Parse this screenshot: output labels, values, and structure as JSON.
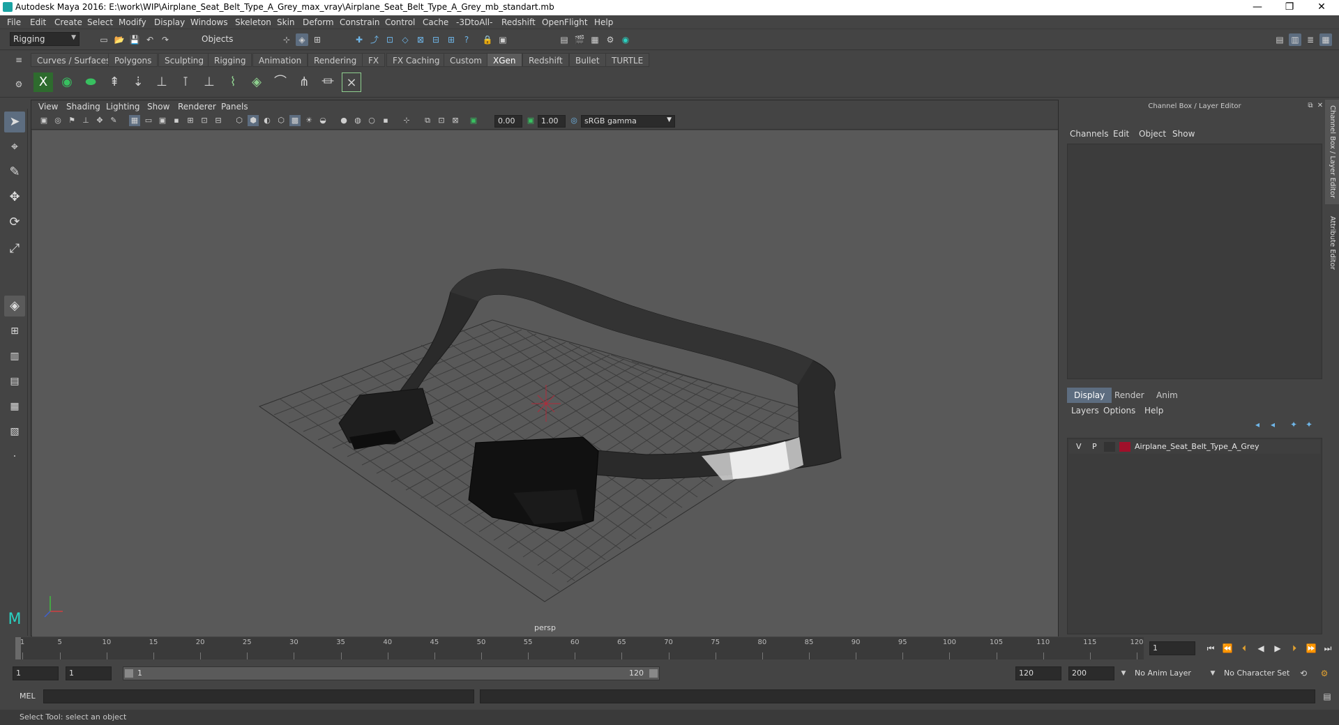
{
  "window": {
    "title": "Autodesk Maya 2016: E:\\work\\WIP\\Airplane_Seat_Belt_Type_A_Grey_max_vray\\Airplane_Seat_Belt_Type_A_Grey_mb_standart.mb",
    "minimize": "—",
    "restore": "❐",
    "close": "✕"
  },
  "menubar": [
    "File",
    "Edit",
    "Create",
    "Select",
    "Modify",
    "Display",
    "Windows",
    "Skeleton",
    "Skin",
    "Deform",
    "Constrain",
    "Control",
    "Cache",
    "-3DtoAll-",
    "Redshift",
    "OpenFlight",
    "Help"
  ],
  "statusline": {
    "menuset": "Rigging",
    "selection_mode": "Objects"
  },
  "shelf_tabs": [
    "Curves / Surfaces",
    "Polygons",
    "Sculpting",
    "Rigging",
    "Animation",
    "Rendering",
    "FX",
    "FX Caching",
    "Custom",
    "XGen",
    "Redshift",
    "Bullet",
    "TURTLE"
  ],
  "active_shelf_tab": "XGen",
  "panel": {
    "menus": [
      "View",
      "Shading",
      "Lighting",
      "Show",
      "Renderer",
      "Panels"
    ],
    "exposure": "0.00",
    "gamma": "1.00",
    "color_space": "sRGB gamma",
    "camera_label": "persp"
  },
  "channel_box": {
    "title": "Channel Box / Layer Editor",
    "menus": [
      "Channels",
      "Edit",
      "Object",
      "Show"
    ]
  },
  "layer_editor": {
    "tabs": [
      "Display",
      "Render",
      "Anim"
    ],
    "active_tab": "Display",
    "menus": [
      "Layers",
      "Options",
      "Help"
    ],
    "layer": {
      "visible": "V",
      "playback": "P",
      "name": "Airplane_Seat_Belt_Type_A_Grey",
      "color": "#a0102a"
    }
  },
  "side_tabs": [
    "Channel Box / Layer Editor",
    "Attribute Editor"
  ],
  "timeline": {
    "ticks": [
      "1",
      "5",
      "10",
      "15",
      "20",
      "25",
      "30",
      "35",
      "40",
      "45",
      "50",
      "55",
      "60",
      "65",
      "70",
      "75",
      "80",
      "85",
      "90",
      "95",
      "100",
      "105",
      "110",
      "115",
      "120"
    ],
    "current_frame": "1"
  },
  "range": {
    "start": "1",
    "playback_start": "1",
    "slider_start": "1",
    "slider_end": "120",
    "playback_end": "120",
    "end": "200",
    "anim_layer": "No Anim Layer",
    "character_set": "No Character Set"
  },
  "command_line": {
    "label": "MEL"
  },
  "help_line": "Select Tool: select an object"
}
